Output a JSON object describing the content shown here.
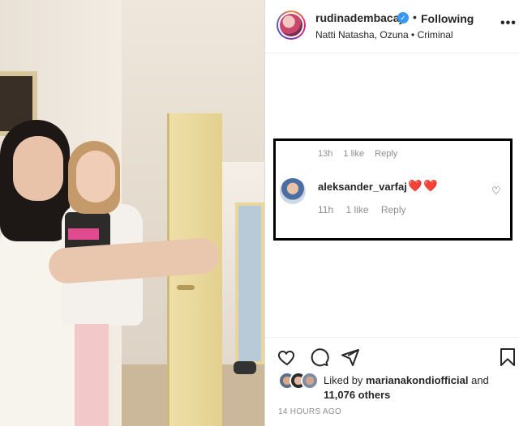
{
  "post": {
    "username": "rudinadembacaj",
    "follow_separator": "•",
    "follow_state": "Following",
    "music": "Natti Natasha, Ozuna • Criminal",
    "more_label": "•••"
  },
  "icons": {
    "verified": "verified-badge-icon",
    "more": "more-options-icon",
    "like": "heart-icon",
    "comment": "comment-bubble-icon",
    "share": "paper-plane-icon",
    "save": "bookmark-icon",
    "comment_like": "small-heart-icon"
  },
  "comments": {
    "partial_previous": {
      "time": "13h",
      "likes": "1 like",
      "reply": "Reply"
    },
    "items": [
      {
        "username": "aleksander_varfaj",
        "text": "❤️❤️",
        "time": "11h",
        "likes": "1 like",
        "reply": "Reply"
      }
    ]
  },
  "likes": {
    "prefix": "Liked by",
    "user": "marianakondiofficial",
    "conjunction": "and",
    "others": "11,076 others"
  },
  "timestamp": "14 HOURS AGO",
  "colors": {
    "verified_blue": "#3897f0",
    "heart_red": "#e0245e",
    "text_dark": "#262626",
    "text_gray": "#8e8e8e",
    "highlight_box": "#000000"
  }
}
